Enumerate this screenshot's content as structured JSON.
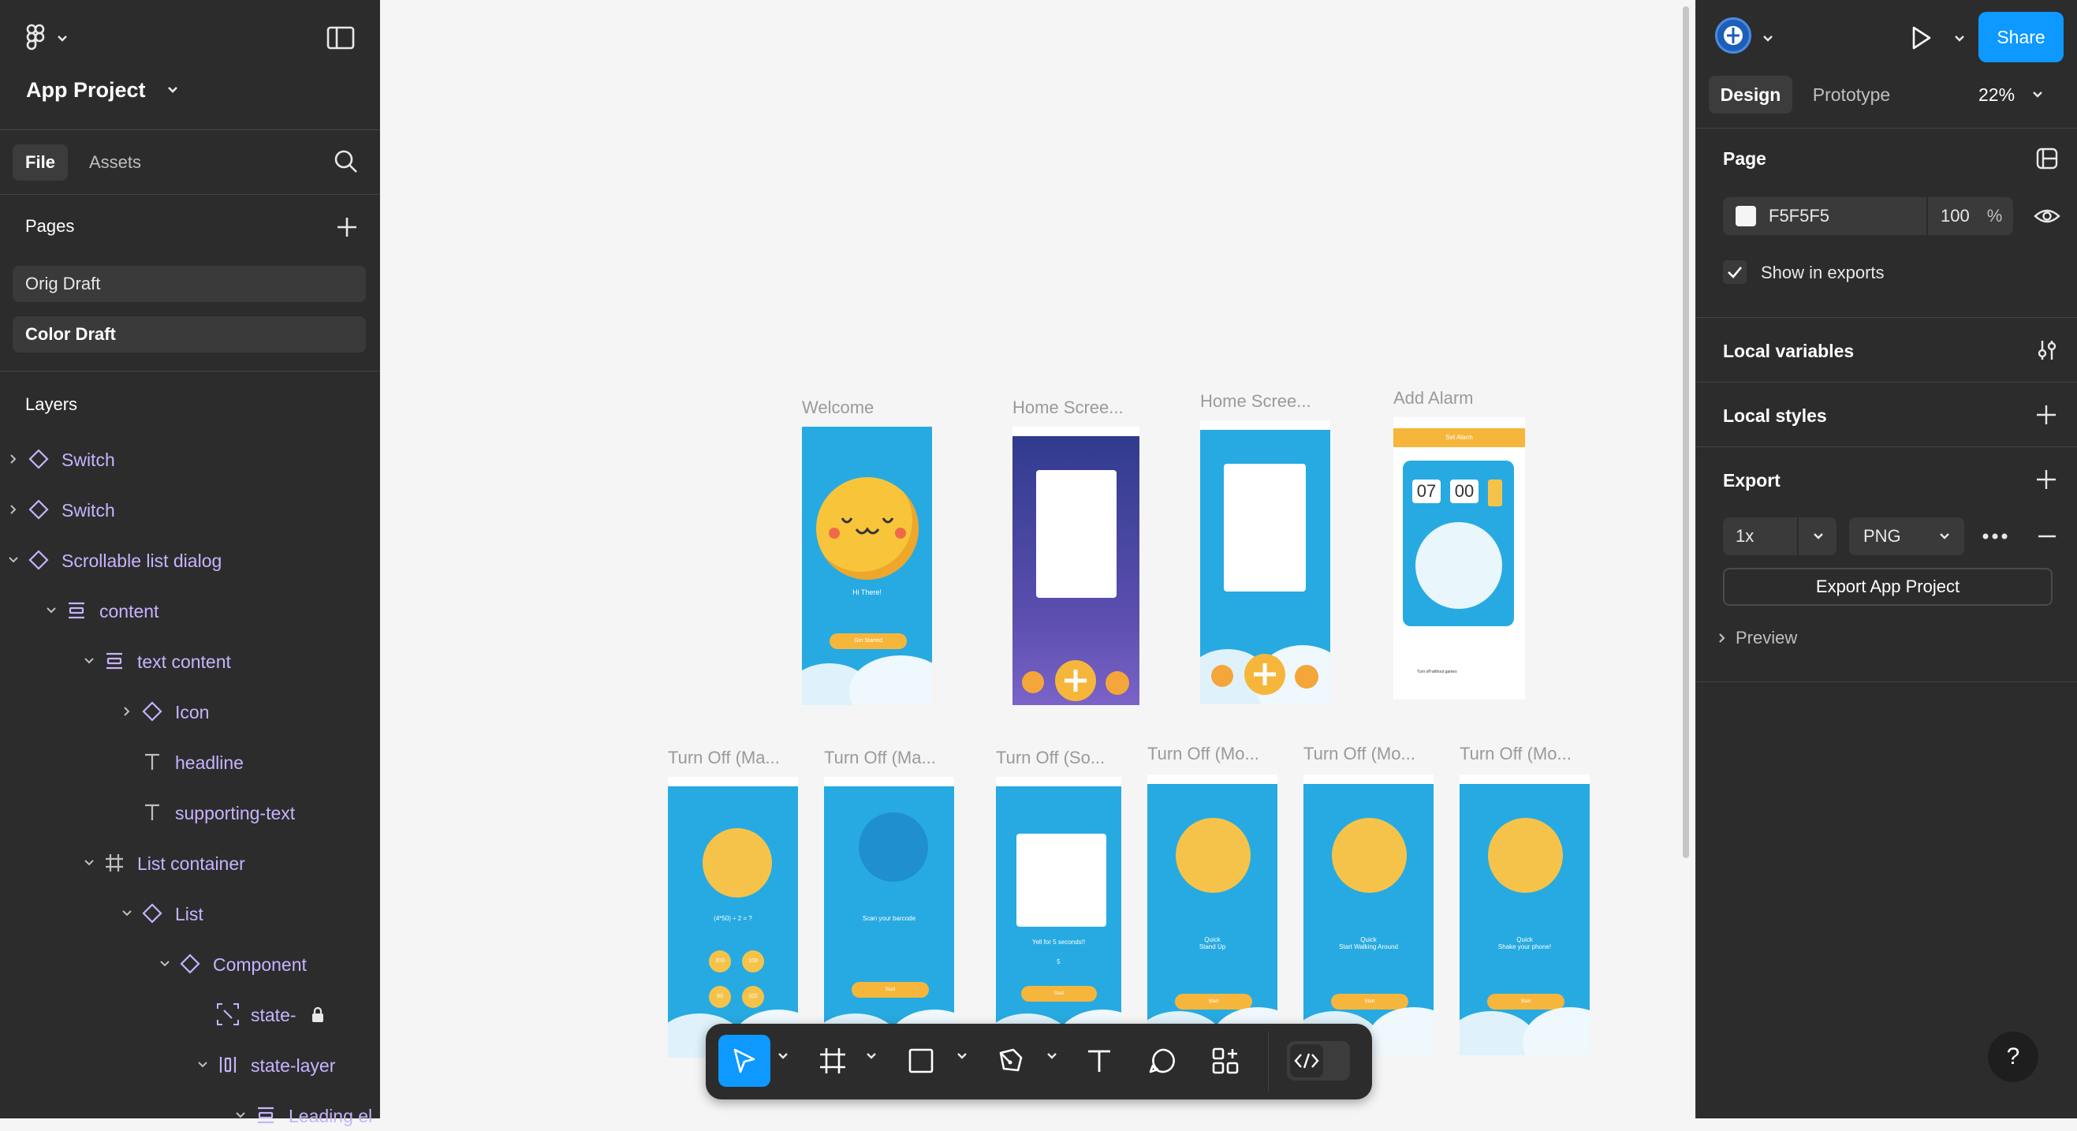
{
  "app": {
    "project_name": "App Project"
  },
  "left_panel": {
    "tabs": [
      "File",
      "Assets"
    ],
    "pages_heading": "Pages",
    "pages": [
      "Orig Draft",
      "Color Draft"
    ],
    "layers_heading": "Layers",
    "layers": [
      {
        "label": "Switch"
      },
      {
        "label": "Switch"
      },
      {
        "label": "Scrollable list dialog"
      },
      {
        "label": "content"
      },
      {
        "label": "text content"
      },
      {
        "label": "Icon"
      },
      {
        "label": "headline"
      },
      {
        "label": "supporting-text"
      },
      {
        "label": "List container"
      },
      {
        "label": "List"
      },
      {
        "label": "Component"
      },
      {
        "label": "state-"
      },
      {
        "label": "state-layer"
      },
      {
        "label": "Leading el"
      }
    ]
  },
  "canvas": {
    "frames": [
      {
        "label": "Welcome"
      },
      {
        "label": "Home Scree..."
      },
      {
        "label": "Home Scree..."
      },
      {
        "label": "Add Alarm"
      },
      {
        "label": "Turn Off (Ma..."
      },
      {
        "label": "Turn Off (Ma..."
      },
      {
        "label": "Turn Off (So..."
      },
      {
        "label": "Turn Off (Mo..."
      },
      {
        "label": "Turn Off (Mo..."
      },
      {
        "label": "Turn Off (Mo..."
      }
    ],
    "mockup_text": {
      "welcome_greeting": "Hi There!",
      "welcome_button": "Get Started",
      "add_alarm_title": "Set Alarm",
      "alarm_hour": "07",
      "alarm_minute": "00",
      "alarm_turn_off_label": "Turn off without games",
      "math_problem": "(4*50) ÷ 2 = ?",
      "math_answers": [
        "200",
        "100",
        "50",
        "102"
      ],
      "scan_text": "Scan your barcode",
      "yell_text": "Yell for 5 seconds!!",
      "yell_count": "5",
      "quick_stand": "Quick\nStand Up",
      "quick_walk": "Quick\nStart Walking Around",
      "quick_shake": "Quick\nShake your phone!",
      "start_label": "Start"
    }
  },
  "right_panel": {
    "share_label": "Share",
    "tabs": [
      "Design",
      "Prototype"
    ],
    "zoom": "22%",
    "page_heading": "Page",
    "page_color": "F5F5F5",
    "page_opacity": "100",
    "percent_sign": "%",
    "show_in_exports_label": "Show in exports",
    "show_in_exports_checked": true,
    "local_variables_label": "Local variables",
    "local_styles_label": "Local styles",
    "export_heading": "Export",
    "export_scale": "1x",
    "export_format": "PNG",
    "export_button_label": "Export App Project",
    "preview_label": "Preview",
    "help_label": "?"
  },
  "colors": {
    "accent": "#0d99ff",
    "panel_bg": "#2c2c2c",
    "canvas_bg": "#f5f5f5",
    "component_purple": "#c7b3ff",
    "app_blue": "#27aae1",
    "app_yellow": "#f6c34a"
  }
}
